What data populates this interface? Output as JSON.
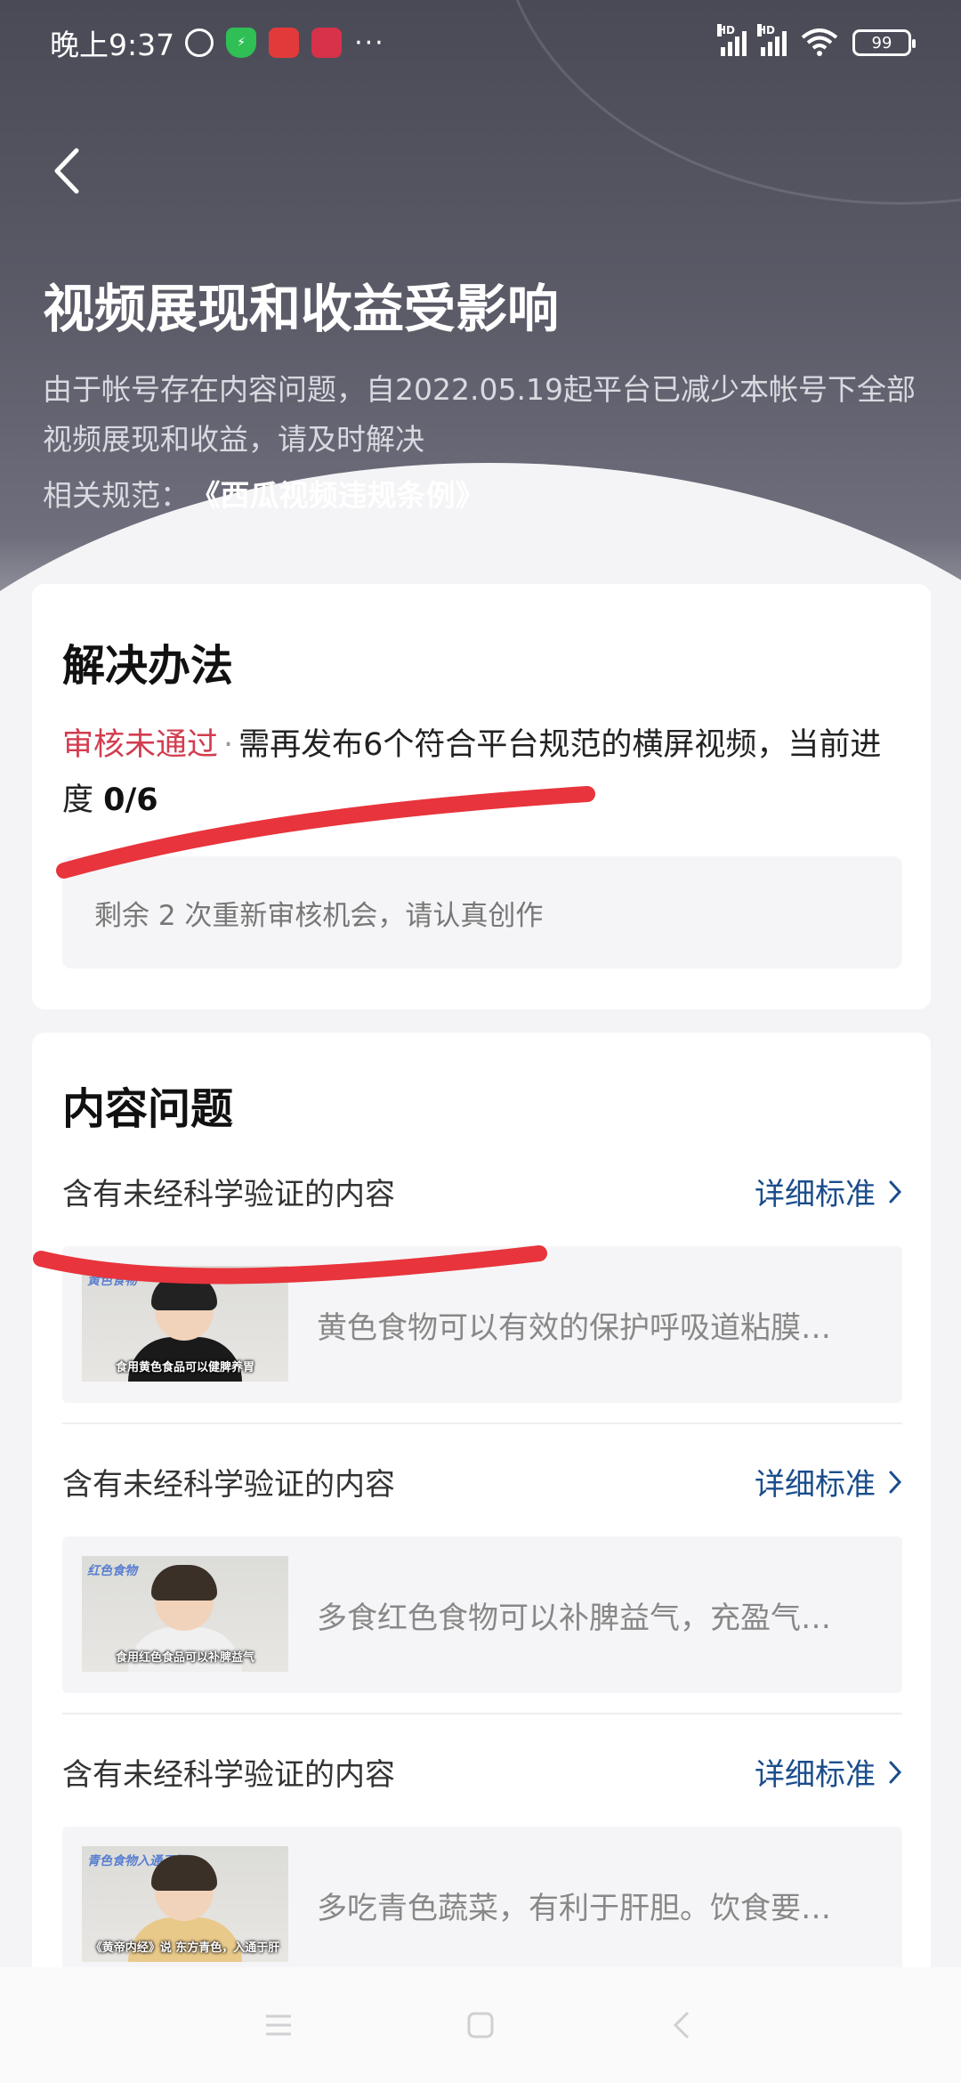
{
  "status_bar": {
    "time": "晚上9:37",
    "more": "···",
    "hd1": "HD",
    "hd2": "HD",
    "battery": "99"
  },
  "header": {
    "title": "视频展现和收益受影响",
    "description": "由于帐号存在内容问题，自2022.05.19起平台已减少本帐号下全部视频展现和收益，请及时解决",
    "rule_prefix": "相关规范：",
    "rule_link": "《西瓜视频违规条例》"
  },
  "solution": {
    "title": "解决办法",
    "status": "审核未通过",
    "separator": "·",
    "text": "需再发布6个符合平台规范的横屏视频，当前进度",
    "progress": "0/6",
    "tip": "剩余 2 次重新审核机会，请认真创作"
  },
  "issues": {
    "title": "内容问题",
    "items": [
      {
        "label": "含有未经科学验证的内容",
        "link": "详细标准",
        "thumb_tag": "黄色食物",
        "thumb_caption": "食用黄色食品可以健脾养胃",
        "text": "黄色食物可以有效的保护呼吸道粘膜…"
      },
      {
        "label": "含有未经科学验证的内容",
        "link": "详细标准",
        "thumb_tag": "红色食物",
        "thumb_caption": "食用红色食品可以补脾益气",
        "text": "多食红色食物可以补脾益气，充盈气…"
      },
      {
        "label": "含有未经科学验证的内容",
        "link": "详细标准",
        "thumb_tag": "青色食物入通于肝",
        "thumb_caption": "《黄帝内经》说 东方青色，入通于肝",
        "text": "多吃青色蔬菜，有利于肝胆。饮食要…"
      }
    ]
  },
  "colors": {
    "header_bg": "#4a4a56",
    "fail_red": "#d23c4f",
    "link_blue": "#1b4d8c",
    "annotation_red": "#e8343c"
  }
}
